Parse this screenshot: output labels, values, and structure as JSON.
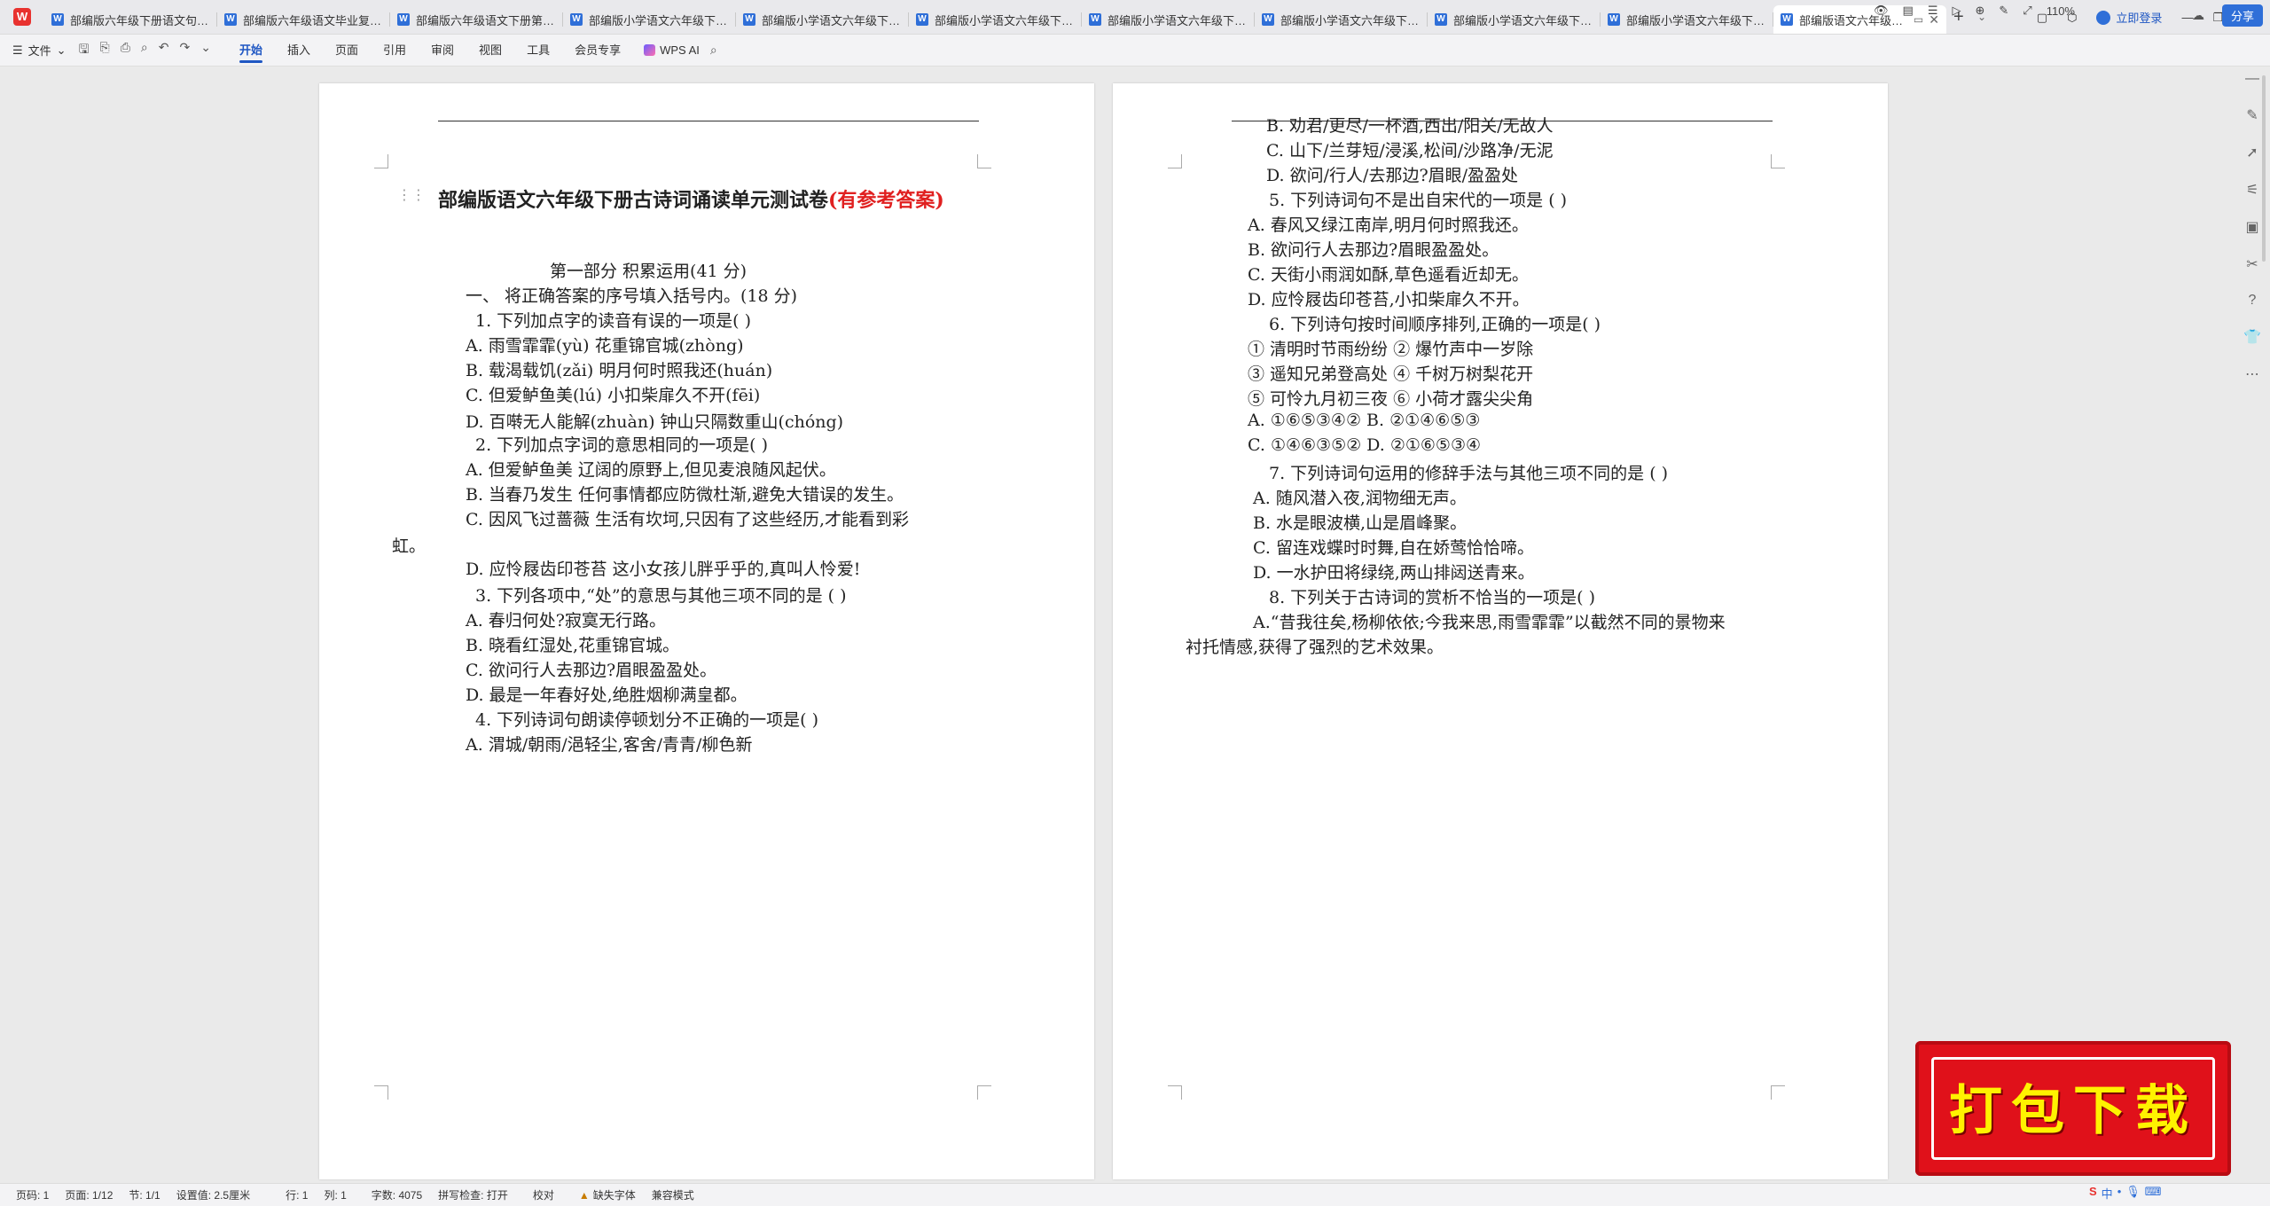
{
  "tabs": [
    {
      "label": "部编版六年级下册语文句子专项"
    },
    {
      "label": "部编版六年级语文毕业复习资料"
    },
    {
      "label": "部编版六年级语文下册第二单元"
    },
    {
      "label": "部编版小学语文六年级下册古诗"
    },
    {
      "label": "部编版小学语文六年级下册第六"
    },
    {
      "label": "部编版小学语文六年级下册第四"
    },
    {
      "label": "部编版小学语文六年级下册第五"
    },
    {
      "label": "部编版小学语文六年级下册古诗"
    },
    {
      "label": "部编版小学语文六年级下册第一"
    },
    {
      "label": "部编版小学语文六年级下册第二"
    },
    {
      "label": "部编版语文六年级下册古诗词诵读单元测试卷"
    }
  ],
  "titlebar": {
    "login": "立即登录"
  },
  "ribbon": {
    "file": "文件",
    "menus": [
      "开始",
      "插入",
      "页面",
      "引用",
      "审阅",
      "视图",
      "工具",
      "会员专享"
    ],
    "wps_ai": "WPS AI",
    "share": "分享"
  },
  "doc": {
    "title_main": "部编版语文六年级下册古诗词诵读单元测试卷",
    "title_red": "(有参考答案)",
    "left_lines": [
      "第一部分  积累运用(41 分)",
      "一、  将正确答案的序号填入括号内。(18 分)",
      "1. 下列加点字的读音有误的一项是(        )",
      "A. 雨雪霏霏(yù)                  花重锦官城(zhòng)",
      "B. 载渴载饥(zǎi)                明月何时照我还(huán)",
      "C. 但爱鲈鱼美(lú)               小扣柴扉久不开(fēi)",
      "D. 百啭无人能解(zhuàn)          钟山只隔数重山(chóng)",
      "2. 下列加点字词的意思相同的一项是(        )",
      "A. 但爱鲈鱼美    辽阔的原野上,但见麦浪随风起伏。",
      "B. 当春乃发生    任何事情都应防微杜渐,避免大错误的发生。",
      "C. 因风飞过蔷薇    生活有坎坷,只因有了这些经历,才能看到彩",
      "虹。",
      "D. 应怜屐齿印苍苔    这小女孩儿胖乎乎的,真叫人怜爱!",
      "3. 下列各项中,“处”的意思与其他三项不同的是 (        )",
      "A. 春归何处?寂寞无行路。",
      "B. 晓看红湿处,花重锦官城。",
      "C. 欲问行人去那边?眉眼盈盈处。",
      "D. 最是一年春好处,绝胜烟柳满皇都。",
      "4. 下列诗词句朗读停顿划分不正确的一项是(        )",
      "A. 渭城/朝雨/浥轻尘,客舍/青青/柳色新"
    ],
    "right_lines": [
      "B. 劝君/更尽/一杯酒,西出/阳关/无故人",
      "C. 山下/兰芽短/浸溪,松间/沙路净/无泥",
      "D. 欲问/行人/去那边?眉眼/盈盈处",
      "5. 下列诗词句不是出自宋代的一项是 (        )",
      "A. 春风又绿江南岸,明月何时照我还。",
      "B. 欲问行人去那边?眉眼盈盈处。",
      "C. 天街小雨润如酥,草色遥看近却无。",
      "D. 应怜屐齿印苍苔,小扣柴扉久不开。",
      "6. 下列诗句按时间顺序排列,正确的一项是(        )",
      "①  清明时节雨纷纷                ②  爆竹声中一岁除",
      "③  遥知兄弟登高处                ④  千树万树梨花开",
      "⑤  可怜九月初三夜                ⑥  小荷才露尖尖角",
      "A. ①⑥⑤③④②        B. ②①④⑥⑤③",
      "C. ①④⑥③⑤②        D. ②①⑥⑤③④",
      "7. 下列诗词句运用的修辞手法与其他三项不同的是 (        )",
      "A. 随风潜入夜,润物细无声。",
      "B. 水是眼波横,山是眉峰聚。",
      "C. 留连戏蝶时时舞,自在娇莺恰恰啼。",
      "D. 一水护田将绿绕,两山排闼送青来。",
      "8. 下列关于古诗词的赏析不恰当的一项是(        )",
      "A.“昔我往矣,杨柳依依;今我来思,雨雪霏霏”以截然不同的景物来",
      "衬托情感,获得了强烈的艺术效果。"
    ]
  },
  "statusbar": {
    "page": "页码: 1",
    "pages": "页面: 1/12",
    "section": "节: 1/1",
    "setting": "设置值: 2.5厘米",
    "row": "行: 1",
    "col": "列: 1",
    "words": "字数: 4075",
    "spell": "拼写检查: 打开",
    "proof": "校对",
    "font_missing": "缺失字体",
    "compat": "兼容模式",
    "zoom": "110%"
  },
  "ime": {
    "label": "中"
  },
  "watermark": {
    "text": "打包下载"
  },
  "colors": {
    "accent": "#1f57c3",
    "title_red": "#e02020",
    "badge": "#e0111a"
  }
}
